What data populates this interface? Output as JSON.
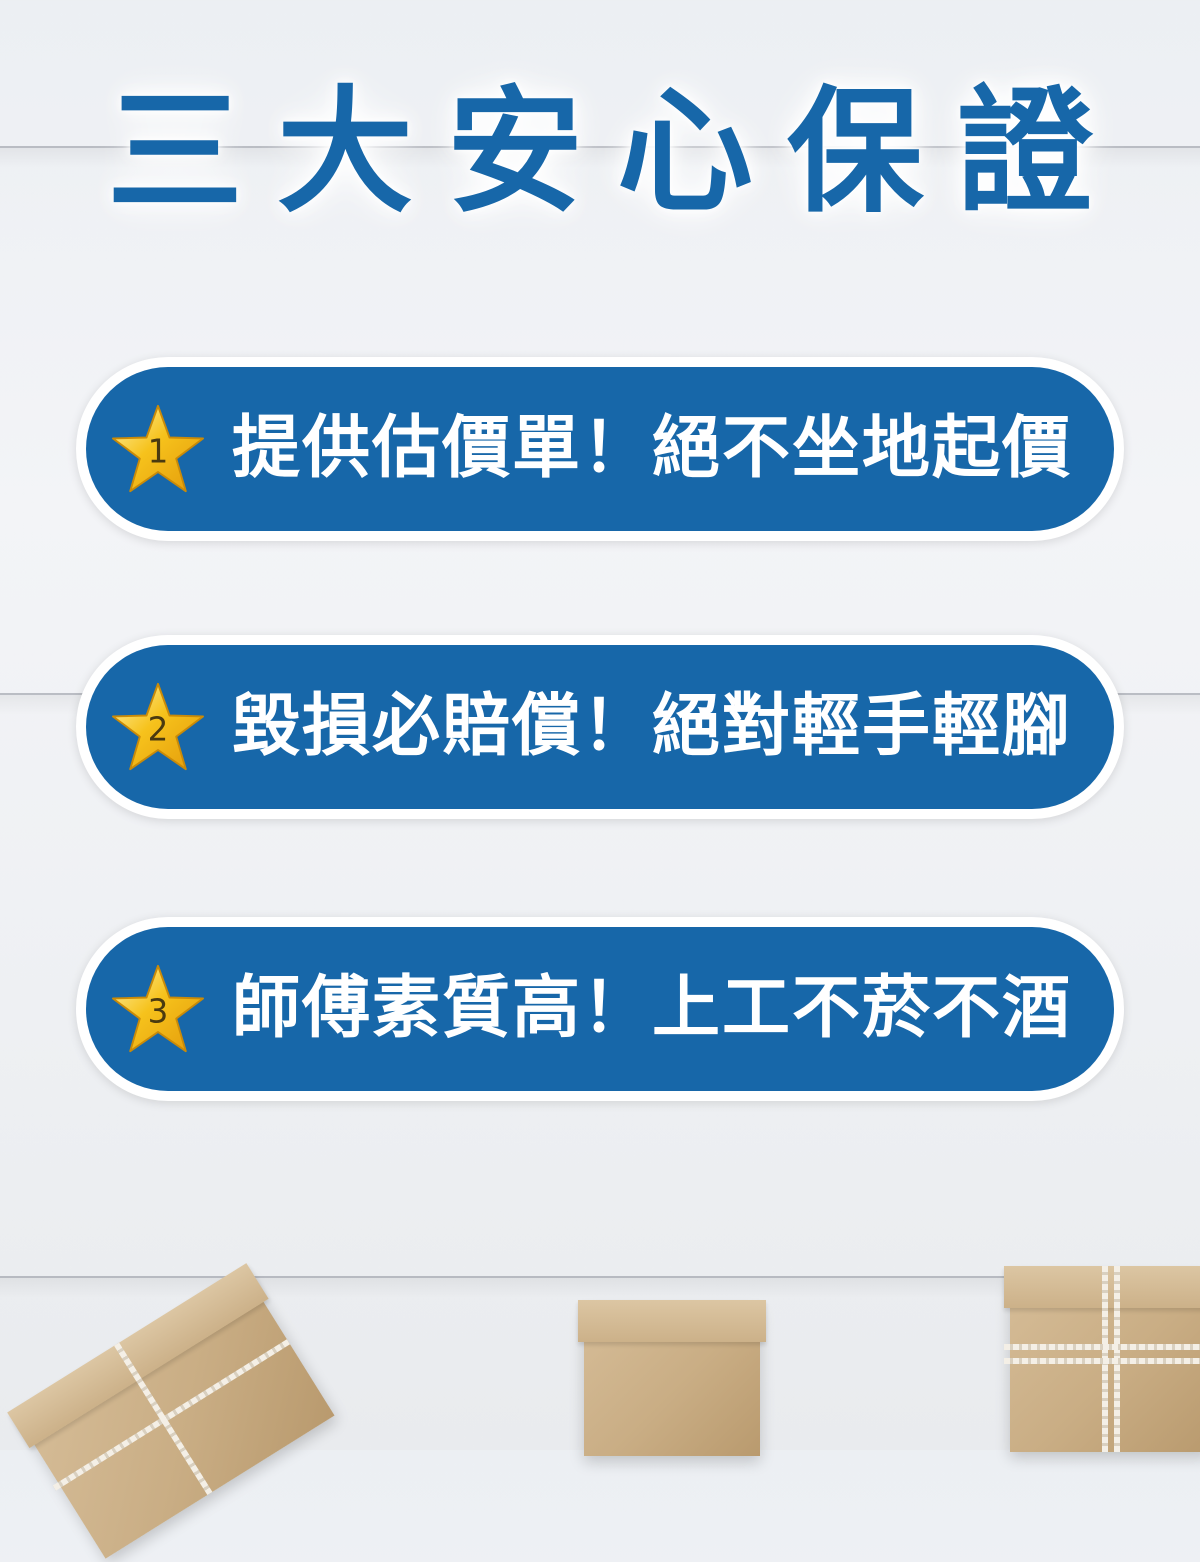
{
  "title": "三大安心保證",
  "guarantees": [
    {
      "number": "1",
      "text": "提供估價單！絕不坐地起價"
    },
    {
      "number": "2",
      "text": "毀損必賠償！絕對輕手輕腳"
    },
    {
      "number": "3",
      "text": "師傅素質高！上工不菸不酒"
    }
  ],
  "colors": {
    "primary_blue": "#1767a9",
    "star_gold": "#f6c21c",
    "text_white": "#ffffff"
  },
  "icons": {
    "star": "star-icon",
    "boxes": "gift-box-icon"
  }
}
